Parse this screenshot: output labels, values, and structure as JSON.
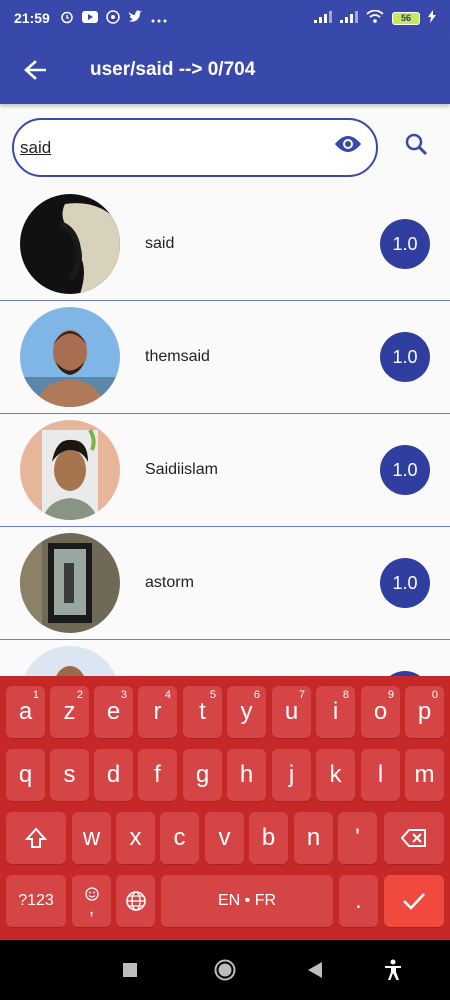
{
  "status_bar": {
    "time": "21:59",
    "left_icons": [
      "alarm-icon",
      "youtube-icon",
      "whatsapp-icon",
      "twitter-icon",
      "more-dots-icon"
    ],
    "battery": "56"
  },
  "app_bar": {
    "title": "user/said --> 0/704"
  },
  "search": {
    "value": "said"
  },
  "users": [
    {
      "name": "said",
      "score": "1.0"
    },
    {
      "name": "themsaid",
      "score": "1.0"
    },
    {
      "name": "Saidiislam",
      "score": "1.0"
    },
    {
      "name": "astorm",
      "score": "1.0"
    },
    {
      "name": "",
      "score": ""
    }
  ],
  "keyboard": {
    "row1": [
      {
        "key": "a",
        "hint": "1"
      },
      {
        "key": "z",
        "hint": "2"
      },
      {
        "key": "e",
        "hint": "3"
      },
      {
        "key": "r",
        "hint": "4"
      },
      {
        "key": "t",
        "hint": "5"
      },
      {
        "key": "y",
        "hint": "6"
      },
      {
        "key": "u",
        "hint": "7"
      },
      {
        "key": "i",
        "hint": "8"
      },
      {
        "key": "o",
        "hint": "9"
      },
      {
        "key": "p",
        "hint": "0"
      }
    ],
    "row2": [
      "q",
      "s",
      "d",
      "f",
      "g",
      "h",
      "j",
      "k",
      "l",
      "m"
    ],
    "row3": [
      "w",
      "x",
      "c",
      "v",
      "b",
      "n",
      "'"
    ],
    "symbols_label": "?123",
    "emoji_comma": ",",
    "space_label": "EN • FR",
    "period": "."
  },
  "colors": {
    "primary": "#3949ab",
    "badge": "#303f9f",
    "keyboard": "#c62828",
    "key": "#d64545"
  }
}
